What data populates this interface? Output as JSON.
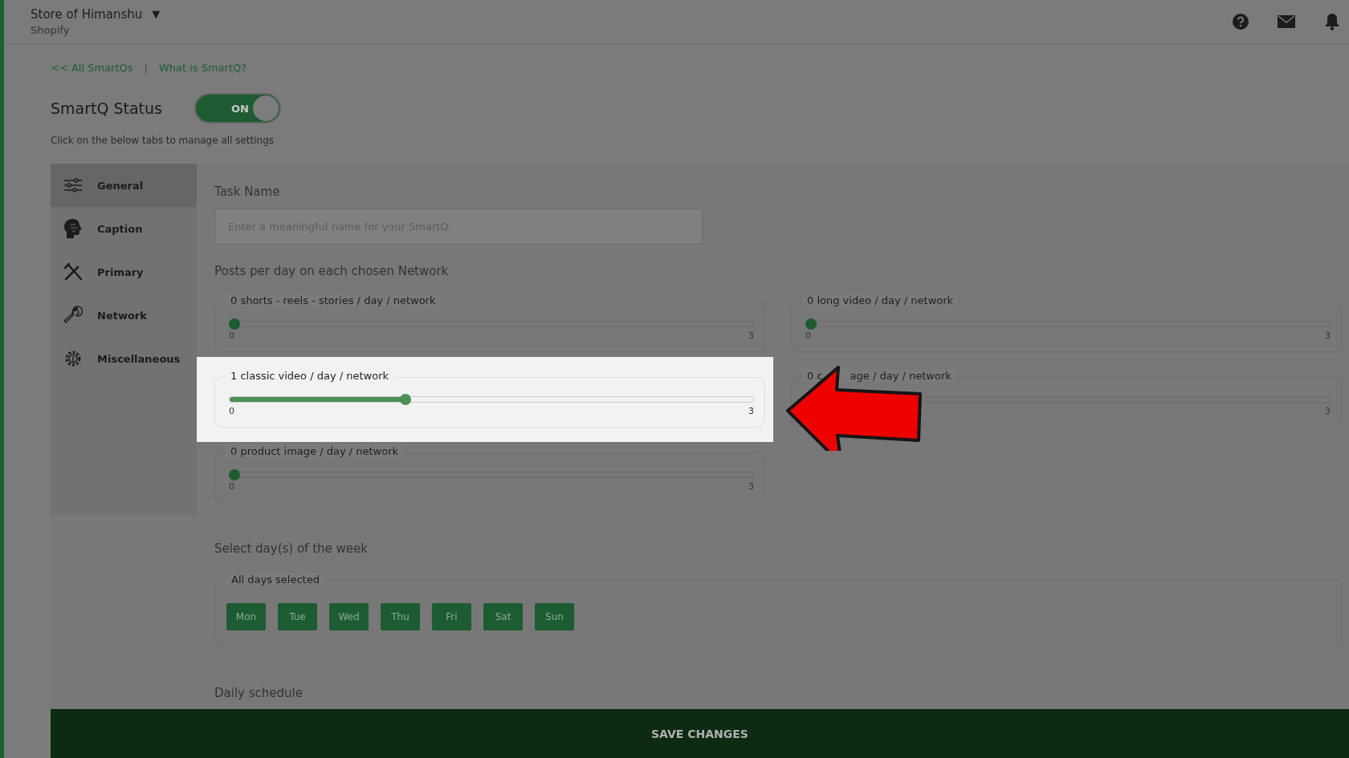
{
  "header": {
    "store": "Store of Himanshu",
    "caret": "▼",
    "platform": "Shopify"
  },
  "links": [
    {
      "label": "<< All SmartQs"
    },
    {
      "label": "What is SmartQ?"
    }
  ],
  "link_separator": "|",
  "status": {
    "title": "SmartQ Status",
    "toggle_label": "ON",
    "on": true,
    "hint": "Click on the below tabs to manage all settings"
  },
  "sidebar": {
    "items": [
      {
        "label": "General",
        "selected": true
      },
      {
        "label": "Caption",
        "selected": false
      },
      {
        "label": "Primary",
        "selected": false
      },
      {
        "label": "Network",
        "selected": false
      },
      {
        "label": "Miscellaneous",
        "selected": false
      }
    ]
  },
  "task": {
    "label": "Task Name",
    "placeholder": "Enter a meaningful name for your SmartQ."
  },
  "posts": {
    "title": "Posts per day on each chosen Network",
    "sliders": [
      {
        "label": "0 shorts - reels - stories / day / network",
        "min": "0",
        "max": "3",
        "level": 0,
        "highlighted": false
      },
      {
        "label": "0 long video / day / network",
        "min": "0",
        "max": "3",
        "level": 0,
        "highlighted": false
      },
      {
        "label": "1 classic video / day / network",
        "min": "0",
        "max": "3",
        "level": 0.333,
        "highlighted": true
      },
      {
        "label_start": "0 c",
        "label_end": "age / day / network",
        "max": "3",
        "highlighted": false
      },
      {
        "label": "0 product image / day / network",
        "min": "0",
        "max": "3",
        "level": 0,
        "highlighted": false
      }
    ]
  },
  "days": {
    "title": "Select day(s) of the week",
    "legend": "All days selected",
    "items": [
      {
        "label": "Mon",
        "selected": true
      },
      {
        "label": "Tue",
        "selected": true
      },
      {
        "label": "Wed",
        "selected": true
      },
      {
        "label": "Thu",
        "selected": true
      },
      {
        "label": "Fri",
        "selected": true
      },
      {
        "label": "Sat",
        "selected": true
      },
      {
        "label": "Sun",
        "selected": true
      }
    ]
  },
  "schedule": {
    "title": "Daily schedule"
  },
  "save": {
    "label": "SAVE CHANGES"
  }
}
